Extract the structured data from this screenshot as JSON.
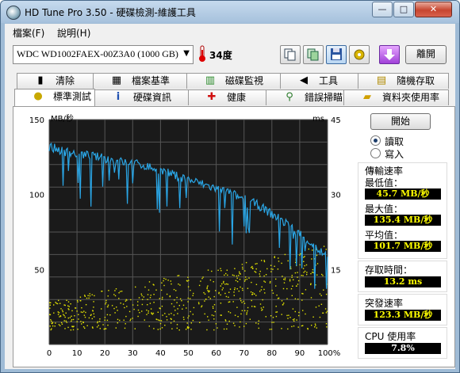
{
  "window": {
    "title": "HD Tune Pro 3.50 - 硬碟檢測-維護工具",
    "min_glyph": "—",
    "max_glyph": "□",
    "close_glyph": "✕"
  },
  "menu": [
    {
      "label": "檔案(F)"
    },
    {
      "label": "說明(H)"
    }
  ],
  "toolbar": {
    "drive": "WDC WD1002FAEX-00Z3A0 (1000 GB)",
    "temperature": "34度",
    "exit_label": "離開"
  },
  "tabs_top": [
    {
      "label": "清除",
      "icon": "trash-icon"
    },
    {
      "label": "檔案基準",
      "icon": "file-benchmark-icon"
    },
    {
      "label": "磁碟監視",
      "icon": "disk-monitor-icon"
    },
    {
      "label": "工具",
      "icon": "speaker-icon"
    },
    {
      "label": "隨機存取",
      "icon": "random-access-icon"
    }
  ],
  "tabs_bottom": [
    {
      "label": "標準測試",
      "icon": "benchmark-icon"
    },
    {
      "label": "硬碟資訊",
      "icon": "info-icon"
    },
    {
      "label": "健康",
      "icon": "health-cross-icon"
    },
    {
      "label": "錯誤掃瞄",
      "icon": "magnifier-icon"
    },
    {
      "label": "資料夾使用率",
      "icon": "folder-icon"
    }
  ],
  "side": {
    "start_label": "開始",
    "read_label": "讀取",
    "write_label": "寫入",
    "selected_mode": "read",
    "transfer_title": "傳輸速率",
    "min_label": "最低值：",
    "min_value": "45.7 MB/秒",
    "max_label": "最大值：",
    "max_value": "135.4 MB/秒",
    "avg_label": "平均值：",
    "avg_value": "101.7 MB/秒",
    "access_label": "存取時間：",
    "access_value": "13.2 ms",
    "burst_label": "突發速率",
    "burst_value": "123.3 MB/秒",
    "cpu_label": "CPU 使用率",
    "cpu_value": "7.8%"
  },
  "chart_data": {
    "type": "line",
    "left_axis_label": "MB/秒",
    "right_axis_label": "ms",
    "left_ylim": [
      0,
      150
    ],
    "right_ylim": [
      0,
      45
    ],
    "left_ticks": [
      "150",
      "100",
      "50"
    ],
    "right_ticks": [
      "45",
      "30",
      "15"
    ],
    "x_ticks": [
      "0",
      "10",
      "20",
      "30",
      "40",
      "50",
      "60",
      "70",
      "80",
      "90",
      "100%"
    ],
    "grid": true,
    "background_color": "#1a1a1a",
    "series": [
      {
        "name": "",
        "color": "#2aa6e6",
        "x": [
          0,
          5,
          10,
          15,
          20,
          25,
          30,
          35,
          40,
          45,
          50,
          55,
          60,
          65,
          70,
          75,
          80,
          85,
          90,
          95,
          100
        ],
        "values": [
          132,
          129,
          127,
          126,
          124,
          122,
          121,
          119,
          116,
          113,
          110,
          107,
          104,
          101,
          97,
          93,
          87,
          81,
          74,
          66,
          58
        ]
      }
    ],
    "access_time_color": "#e6e600",
    "access_time_range_ms": [
      3,
      20
    ]
  }
}
